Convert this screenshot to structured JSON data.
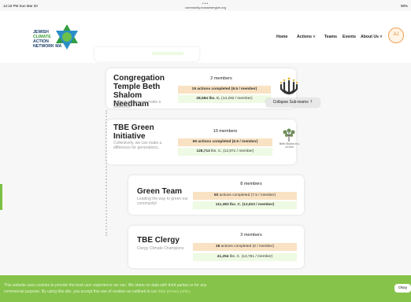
{
  "status_bar": {
    "time": "12:16 PM  Sun Mar 20",
    "url": "community.massenergize.org",
    "dots": "•••",
    "system": "98%"
  },
  "header": {
    "logo_lines": [
      "JEWISH",
      "CLIMATE",
      "ACTION",
      "NETWORK MA"
    ],
    "nav": {
      "home": "Home",
      "actions": "Actions",
      "teams": "Teams",
      "events": "Events",
      "about": "About Us"
    },
    "avatar_initials": "AJ"
  },
  "teams": [
    {
      "name": "Congregation Temple Beth Shalom Needham",
      "description": "Collectively we can make a difference!",
      "members": "2 members",
      "actions_bold": "19 actions completed (9.5 / member)",
      "carbon_bold": "28,584 lbs. C.",
      "carbon_rest": " (14,292 / member)"
    },
    {
      "name": "TBE Green Initiative",
      "description": "Collectively, we can make a difference for generations.",
      "members": "10 members",
      "actions_bold": "69 actions completed (6.9 / member)",
      "carbon_bold": "128,713",
      "carbon_rest": " lbs. C. (12,871 / member)",
      "logo_text": "Beth Elohim בית אלוהים"
    },
    {
      "name": "Green Team",
      "description": "Leading the way to green our community!",
      "members": "8 members",
      "actions_bold": "60",
      "actions_rest": " actions completed (7.5 / member)",
      "carbon_bold": "111,383 lbs. C. (13,923 / member)"
    },
    {
      "name": "TBE Clergy",
      "description": "Clergy Climate Champions",
      "members": "3 members",
      "actions_bold": "18",
      "actions_rest": " actions completed (6 / member)",
      "carbon_bold": "41,254",
      "carbon_rest": " lbs. C. (13,751 / member)"
    }
  ],
  "collapse_label": "Collapse Sub-teams ⇡",
  "cookie": {
    "text1": "This website uses cookies to provide the best user experience we can. We share no data with third parties or for any",
    "text2": "commercial purpose. By using this site, you accept this use of cookies as outlined in our",
    "link": "data privacy policy",
    "okay": "Okay"
  }
}
